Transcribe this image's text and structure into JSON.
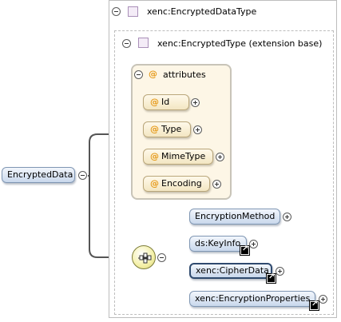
{
  "root_element": {
    "label": "EncryptedData"
  },
  "type_header": {
    "label": "xenc:EncryptedDataType"
  },
  "extension_header": {
    "label": "xenc:EncryptedType (extension base)"
  },
  "attributes_group": {
    "label": "attributes",
    "items": [
      {
        "label": "Id"
      },
      {
        "label": "Type"
      },
      {
        "label": "MimeType"
      },
      {
        "label": "Encoding"
      }
    ]
  },
  "sequence": {
    "children": [
      {
        "label": "EncryptionMethod"
      },
      {
        "label": "ds:KeyInfo"
      },
      {
        "label": "xenc:CipherData"
      },
      {
        "label": "xenc:EncryptionProperties"
      }
    ]
  },
  "colors": {
    "element_fill": "#c9d8ec",
    "attribute_fill": "#f3e6c2",
    "attribute_marker": "#e69a1a",
    "type_icon": "#a98fb8"
  },
  "icons": [
    "collapse-icon",
    "expand-icon",
    "type-icon",
    "attribute-icon",
    "sequence-icon",
    "reference-icon"
  ]
}
